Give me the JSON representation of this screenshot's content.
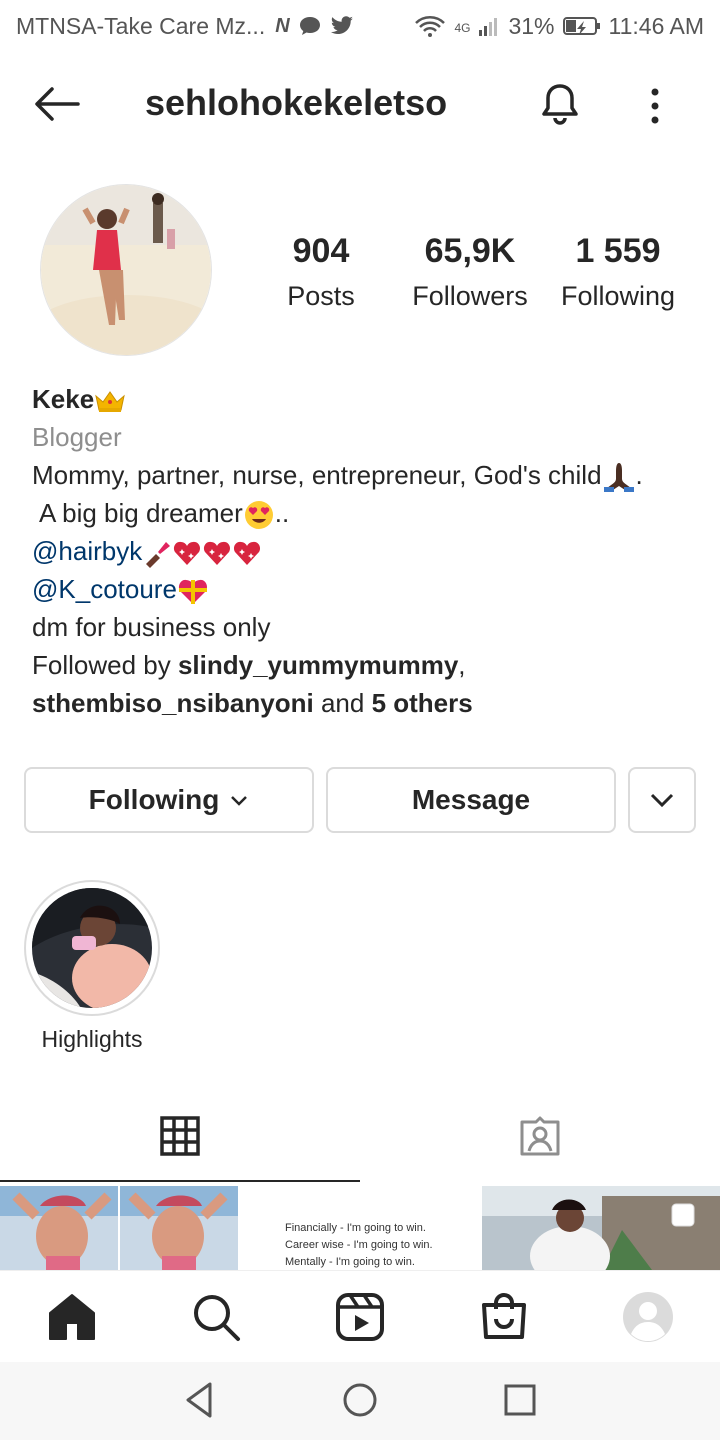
{
  "status_bar": {
    "carrier": "MTNSA-Take Care Mz...",
    "network": "4G",
    "battery": "31%",
    "time": "11:46 AM"
  },
  "header": {
    "username": "sehlohokekeletso"
  },
  "stats": [
    {
      "value": "904",
      "label": "Posts"
    },
    {
      "value": "65,9K",
      "label": "Followers"
    },
    {
      "value": "1 559",
      "label": "Following"
    }
  ],
  "bio": {
    "name": "Keke",
    "category": "Blogger",
    "line1": "Mommy, partner, nurse, entrepreneur, God's child",
    "line1_end": ".",
    "line2": "A big big dreamer",
    "line2_end": "..",
    "link1": "@hairbyk",
    "link2": "@K_cotoure",
    "line3": "dm for business only",
    "followed_by_prefix": "Followed by ",
    "followed_user1": "slindy_yummymummy",
    "comma": ",",
    "followed_user2": "sthembiso_nsibanyoni",
    "and": " and ",
    "others": "5 others"
  },
  "buttons": {
    "following": "Following",
    "message": "Message"
  },
  "highlights": [
    {
      "label": "Highlights"
    }
  ],
  "grid_quote": [
    "Financially - I'm going to win.",
    "Career wise - I'm going to win.",
    "Mentally - I'm going to win."
  ],
  "colors": {
    "link": "#00376b",
    "secondary_text": "#8e8e8e",
    "border": "#dbdbdb"
  }
}
